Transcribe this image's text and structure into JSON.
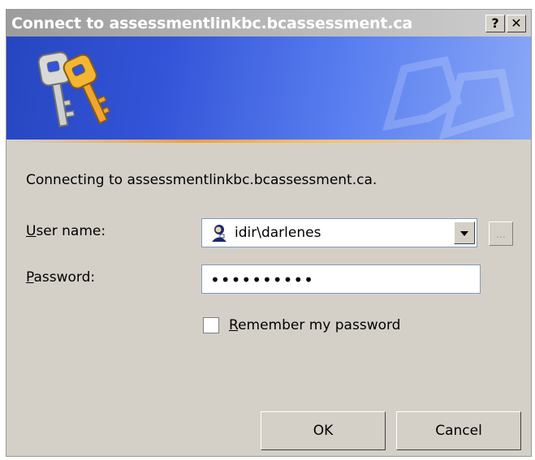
{
  "window": {
    "title": "Connect to assessmentlinkbc.bcassessment.ca",
    "help_button": "?",
    "close_button": "✕"
  },
  "message": "Connecting to assessmentlinkbc.bcassessment.ca.",
  "username": {
    "label_underlined": "U",
    "label_rest": "ser name:",
    "value": "idir\\darlenes",
    "browse_label": "..."
  },
  "password": {
    "label_underlined": "P",
    "label_rest": "assword:",
    "value": "••••••••••"
  },
  "remember": {
    "label_underlined": "R",
    "label_rest": "emember my password",
    "checked": false
  },
  "buttons": {
    "ok": "OK",
    "cancel": "Cancel"
  },
  "colors": {
    "dialog_bg": "#d4d0c8",
    "banner_blue": "#3354d8",
    "banner_accent": "#f0a040"
  }
}
